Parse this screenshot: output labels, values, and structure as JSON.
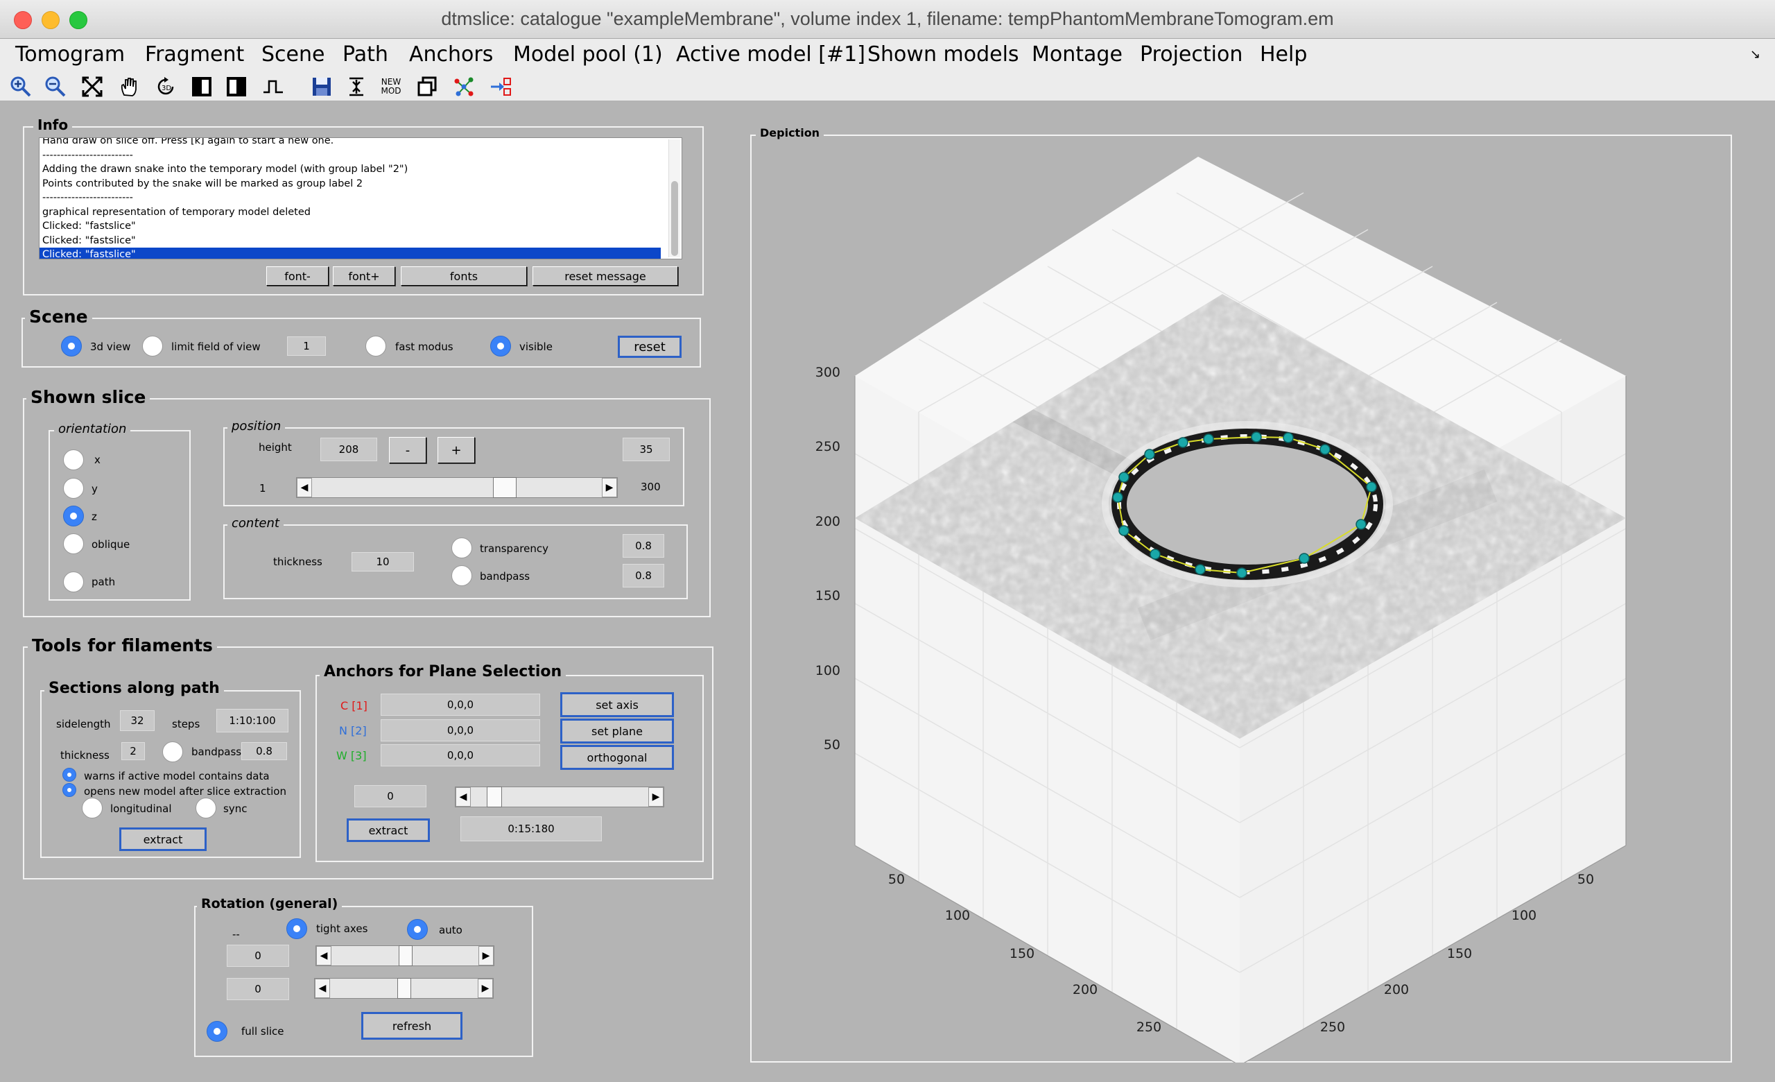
{
  "window": {
    "title": "dtmslice: catalogue \"exampleMembrane\", volume index 1, filename: tempPhantomMembraneTomogram.em"
  },
  "menu": [
    "Tomogram",
    "Fragment",
    "Scene",
    "Path",
    "Anchors",
    "Model pool (1)",
    "Active model [#1]",
    "Shown models",
    "Montage",
    "Projection",
    "Help"
  ],
  "toolbar": {
    "icons": [
      "zoom-in-icon",
      "zoom-out-icon",
      "fit-view-icon",
      "pan-hand-icon",
      "rotate-3d-icon",
      "contrast-left-icon",
      "contrast-right-icon",
      "step-function-icon",
      "save-icon",
      "center-icon",
      "new-model-icon",
      "copy-model-icon",
      "network-icon",
      "transfer-icon"
    ],
    "new_mod_label_1": "NEW",
    "new_mod_label_2": "MOD"
  },
  "info": {
    "title": "Info",
    "messages": [
      "Hand draw on slice off. Press [k] again to start a new one.",
      "-------------------------",
      "Adding the drawn snake into the temporary model (with group label \"2\")",
      "Points contributed by the snake will be marked as group label 2",
      "-------------------------",
      "graphical representation of temporary model deleted",
      "Clicked: \"fastslice\"",
      "Clicked: \"fastslice\"",
      "Clicked: \"fastslice\""
    ],
    "buttons": {
      "font_minus": "font-",
      "font_plus": "font+",
      "fonts": "fonts",
      "reset_message": "reset message"
    }
  },
  "scene": {
    "title": "Scene",
    "view3d": "3d view",
    "limit": "limit field of view",
    "limit_value": "1",
    "fast": "fast modus",
    "visible": "visible",
    "reset": "reset"
  },
  "shown_slice": {
    "title": "Shown slice",
    "orientation": {
      "title": "orientation",
      "x": "x",
      "y": "y",
      "z": "z",
      "oblique": "oblique",
      "path": "path",
      "selected": "z"
    },
    "position": {
      "title": "position",
      "height_label": "height",
      "height_value": "208",
      "minus": "-",
      "plus": "+",
      "step_value": "35",
      "slider_min": "1",
      "slider_max": "300",
      "slider_level": 0.68
    },
    "content": {
      "title": "content",
      "thickness_label": "thickness",
      "thickness_value": "10",
      "transparency": "transparency",
      "transparency_value": "0.8",
      "bandpass": "bandpass",
      "bandpass_value": "0.8"
    }
  },
  "filaments": {
    "title": "Tools for filaments",
    "sections": {
      "title": "Sections along path",
      "sidelength_label": "sidelength",
      "sidelength_value": "32",
      "steps_label": "steps",
      "steps_value": "1:10:100",
      "thickness_label": "thickness",
      "thickness_value": "2",
      "bandpass_label": "bandpass",
      "bandpass_value": "0.8",
      "warns": "warns if active model contains data",
      "opens": "opens new model after slice extraction",
      "longitudinal": "longitudinal",
      "sync": "sync",
      "extract": "extract"
    },
    "anchors": {
      "title": "Anchors for Plane Selection",
      "c_label": "C [1]",
      "c_value": "0,0,0",
      "n_label": "N [2]",
      "n_value": "0,0,0",
      "w_label": "W [3]",
      "w_value": "0,0,0",
      "set_axis": "set axis",
      "set_plane": "set plane",
      "orthogonal": "orthogonal",
      "angle_value": "0",
      "range_value": "0:15:180",
      "extract": "extract",
      "slider_level": 0.1,
      "colors": {
        "c": "#e01818",
        "n": "#2f6fd8",
        "w": "#1fae2a"
      }
    }
  },
  "rotation": {
    "title": "Rotation (general)",
    "dashes": "--",
    "tight_axes": "tight axes",
    "auto": "auto",
    "value1": "0",
    "value2": "0",
    "full_slice": "full slice",
    "refresh": "refresh"
  },
  "depiction": {
    "title": "Depiction",
    "z_ticks": [
      "300",
      "250",
      "200",
      "150",
      "100",
      "50"
    ],
    "x_ticks": [
      "50",
      "100",
      "150",
      "200",
      "250"
    ],
    "y_ticks": [
      "50",
      "100",
      "150",
      "200",
      "250"
    ]
  }
}
